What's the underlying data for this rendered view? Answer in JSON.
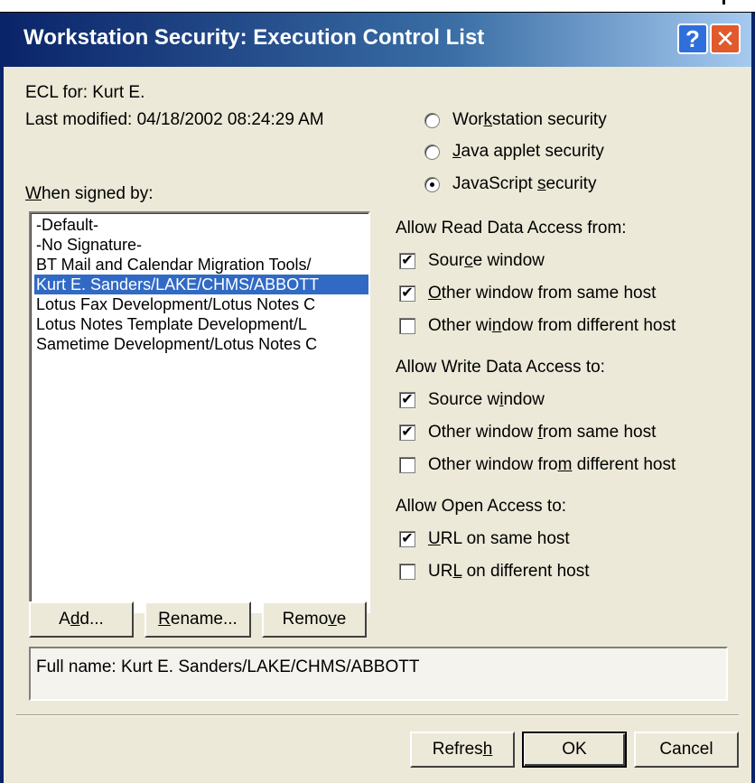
{
  "window": {
    "title": "Workstation Security:  Execution Control List",
    "help_glyph": "?",
    "close_glyph": "✕"
  },
  "info": {
    "ecl_for": "ECL for:  Kurt E.",
    "last_modified": "Last modified:  04/18/2002 08:24:29 AM"
  },
  "security_type": {
    "selected": "javascript",
    "options": [
      {
        "pre": "Wor",
        "key": "k",
        "post": "station security"
      },
      {
        "pre": "",
        "key": "J",
        "post": "ava applet security"
      },
      {
        "pre": "JavaScript ",
        "key": "s",
        "post": "ecurity"
      }
    ]
  },
  "signed_by": {
    "label_key": "W",
    "label_rest": "hen signed by:",
    "items": [
      "-Default-",
      "-No Signature-",
      "BT Mail and Calendar Migration Tools/",
      "Kurt E. Sanders/LAKE/CHMS/ABBOTT",
      "Lotus Fax Development/Lotus Notes C",
      "Lotus Notes Template Development/L",
      "Sametime Development/Lotus Notes C"
    ],
    "selected_index": 3
  },
  "read_access": {
    "heading": "Allow Read Data Access from:",
    "options": [
      {
        "pre": "Sour",
        "key": "c",
        "post": "e window",
        "checked": true
      },
      {
        "pre": "",
        "key": "O",
        "post": "ther window from same host",
        "checked": true
      },
      {
        "pre": "Other wi",
        "key": "n",
        "post": "dow from different host",
        "checked": false
      }
    ]
  },
  "write_access": {
    "heading": "Allow Write Data Access to:",
    "options": [
      {
        "pre": "Source w",
        "key": "i",
        "post": "ndow",
        "checked": true
      },
      {
        "pre": "Other window ",
        "key": "f",
        "post": "rom same host",
        "checked": true
      },
      {
        "pre": "Other window fro",
        "key": "m",
        "post": " different host",
        "checked": false
      }
    ]
  },
  "open_access": {
    "heading": "Allow Open Access to:",
    "options": [
      {
        "pre": "",
        "key": "U",
        "post": "RL on same host",
        "checked": true
      },
      {
        "pre": "UR",
        "key": "L",
        "post": " on different host",
        "checked": false
      }
    ]
  },
  "list_buttons": {
    "add": {
      "pre": "A",
      "key": "d",
      "post": "d..."
    },
    "rename": {
      "pre": "",
      "key": "R",
      "post": "ename..."
    },
    "remove": {
      "pre": "Remo",
      "key": "v",
      "post": "e"
    }
  },
  "full_name": "Full name: Kurt E. Sanders/LAKE/CHMS/ABBOTT",
  "footer_buttons": {
    "refresh": {
      "pre": "Refres",
      "key": "h",
      "post": ""
    },
    "ok": "OK",
    "cancel": "Cancel"
  },
  "check_mark": "✔"
}
